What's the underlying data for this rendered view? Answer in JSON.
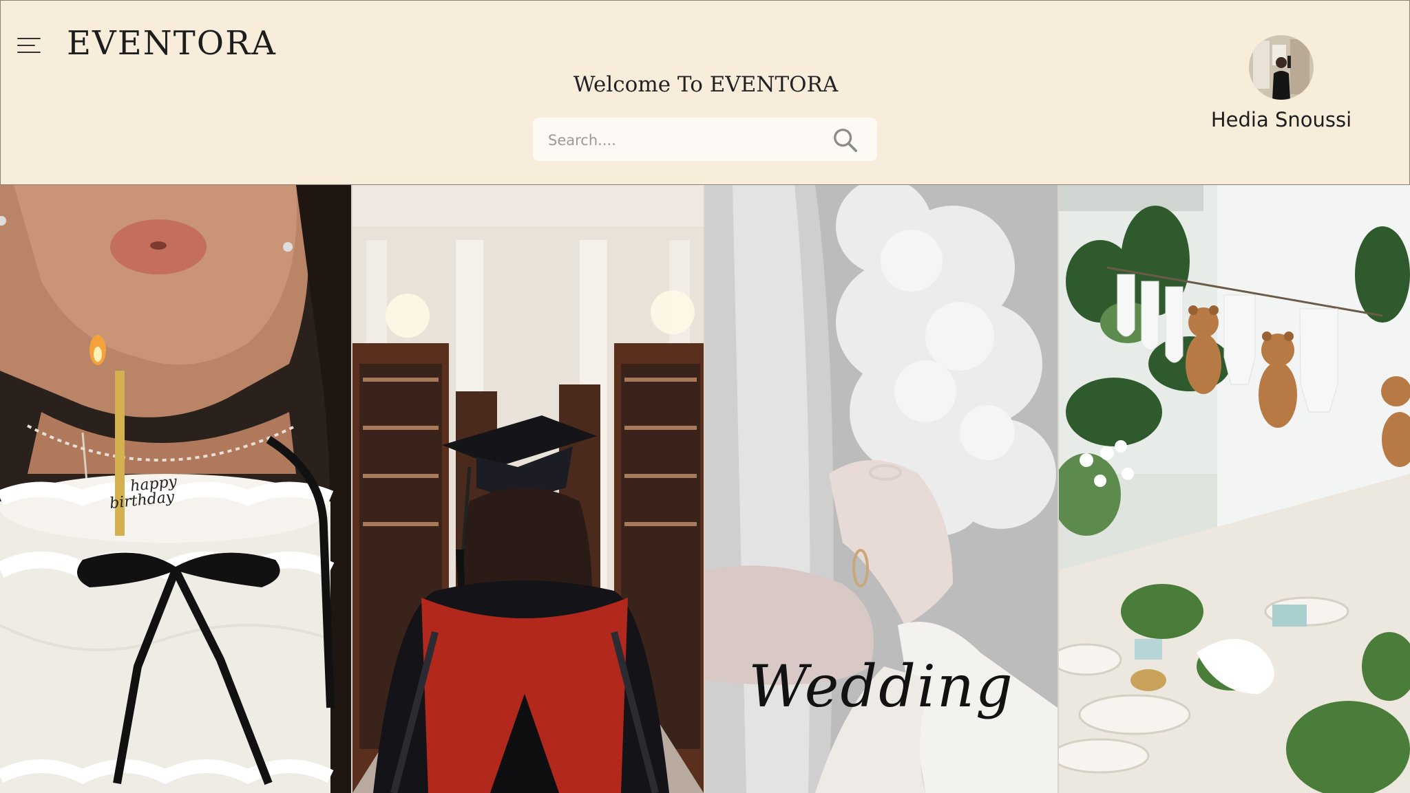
{
  "app": {
    "logo_text": "EVENTORA",
    "welcome_text": "Welcome To EVENTORA"
  },
  "search": {
    "placeholder": "Search....",
    "value": ""
  },
  "user": {
    "name": "Hedia Snoussi"
  },
  "icons": {
    "menu": "hamburger-menu-icon",
    "search": "search-icon"
  },
  "colors": {
    "header_bg": "#f8ecdb",
    "search_bg": "#fdf9f5",
    "text": "#1d1d1d"
  },
  "categories": [
    {
      "caption": "",
      "image": "birthday cake with candle being blown out"
    },
    {
      "caption": "",
      "image": "graduate in cap and gown in a library"
    },
    {
      "caption": "Wedding",
      "image": "couple holding hands with white bouquet"
    },
    {
      "caption": "",
      "image": "baby shower table with bunting of onesies and teddy bears"
    }
  ]
}
